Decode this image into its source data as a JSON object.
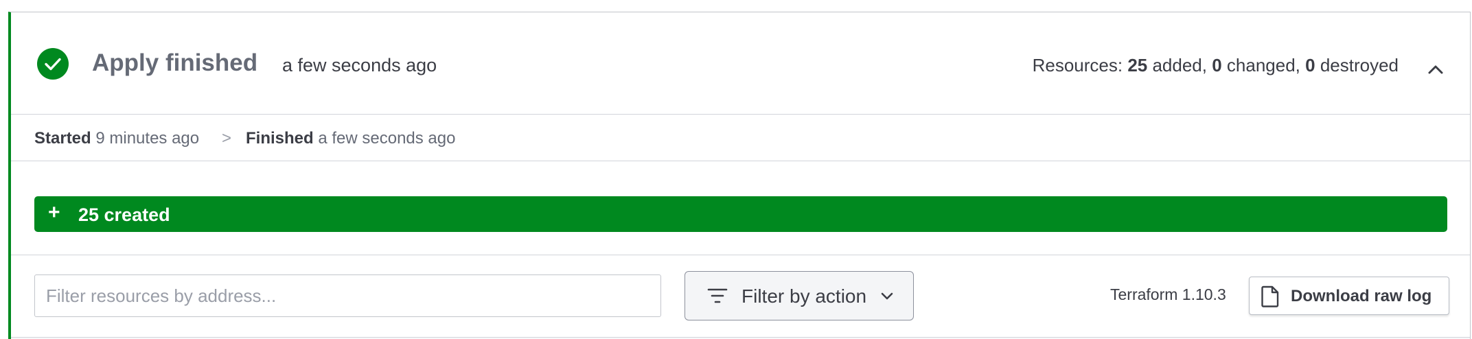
{
  "header": {
    "title": "Apply finished",
    "time": "a few seconds ago",
    "resources": {
      "prefix": "Resources: ",
      "added_count": "25",
      "added_label": " added, ",
      "changed_count": "0",
      "changed_label": " changed, ",
      "destroyed_count": "0",
      "destroyed_label": " destroyed"
    },
    "status_icon": "check-circle-icon",
    "collapse_icon": "chevron-up-icon"
  },
  "timeline": {
    "started_label": "Started",
    "started_time": "9 minutes ago",
    "separator": ">",
    "finished_label": "Finished",
    "finished_time": "a few seconds ago"
  },
  "created": {
    "symbol": "+",
    "label": "25 created"
  },
  "filters": {
    "search_placeholder": "Filter resources by address...",
    "search_value": "",
    "filter_button_label": "Filter by action",
    "terraform_version": "Terraform 1.10.3",
    "download_label": "Download raw log"
  },
  "colors": {
    "success": "#00891f",
    "text": "#3b3d45",
    "muted": "#656a76"
  }
}
